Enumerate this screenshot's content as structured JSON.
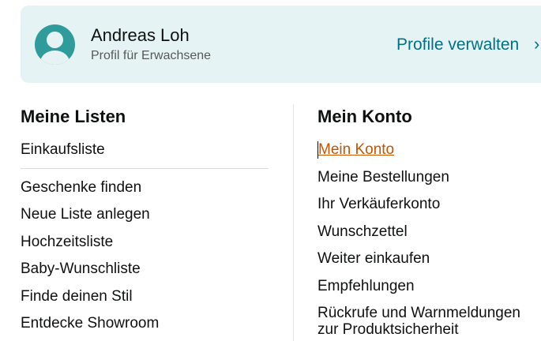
{
  "profile": {
    "name": "Andreas Loh",
    "subtitle": "Profil für Erwachsene",
    "manage_label": "Profile verwalten",
    "chevron_glyph": "›"
  },
  "lists": {
    "title": "Meine Listen",
    "primary_item": "Einkaufsliste",
    "items": [
      "Geschenke finden",
      "Neue Liste anlegen",
      "Hochzeitsliste",
      "Baby-Wunschliste",
      "Finde deinen Stil",
      "Entdecke Showroom"
    ]
  },
  "account": {
    "title": "Mein Konto",
    "items": [
      "Mein Konto",
      "Meine Bestellungen",
      "Ihr Verkäuferkonto",
      "Wunschzettel",
      "Weiter einkaufen",
      "Empfehlungen",
      "Rückrufe und Warnmeldungen",
      "zur Produktsicherheit"
    ]
  },
  "colors": {
    "card_bg": "#e6f3f4",
    "link": "#007185",
    "active_link": "#c45500",
    "text": "#0f1111",
    "muted": "#565959"
  }
}
